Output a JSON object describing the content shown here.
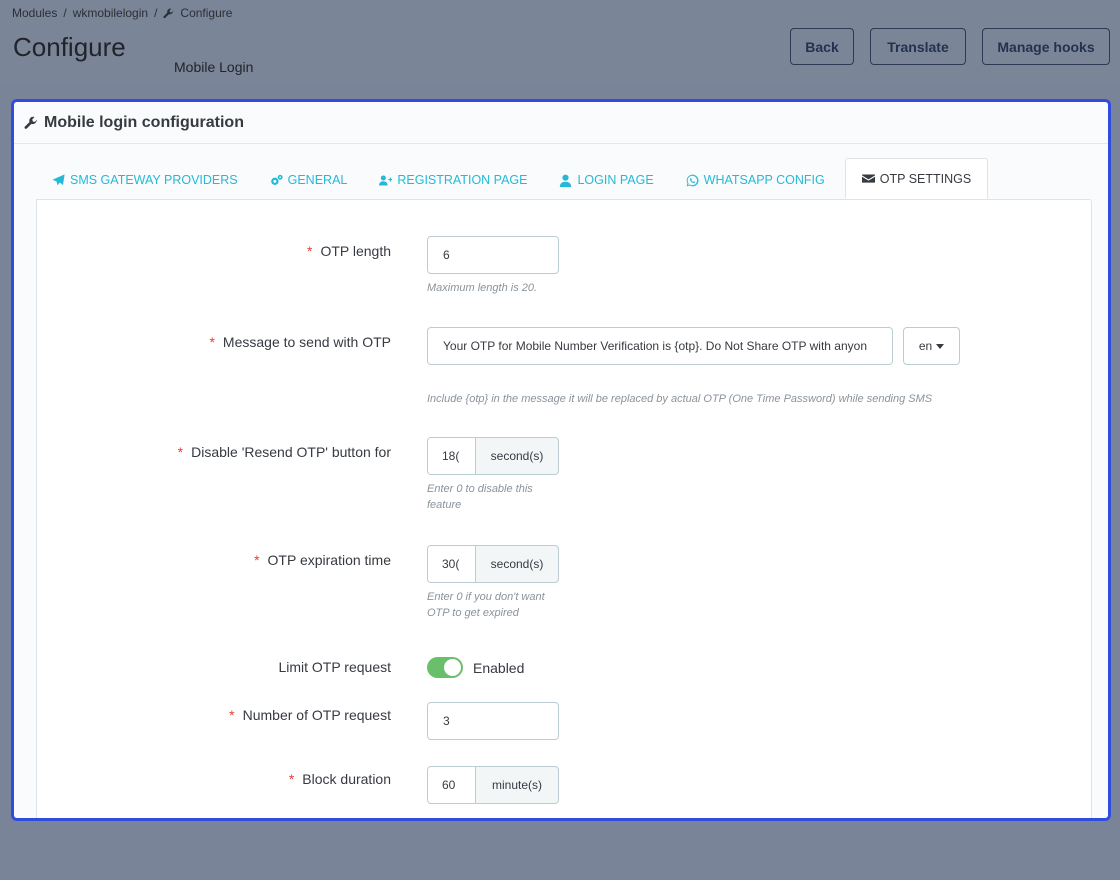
{
  "breadcrumb": {
    "items": [
      "Modules",
      "wkmobilelogin",
      "Configure"
    ]
  },
  "header": {
    "title": "Configure",
    "subtitle": "Mobile Login",
    "buttons": {
      "back": "Back",
      "translate": "Translate",
      "manage_hooks": "Manage hooks"
    }
  },
  "panel": {
    "title": "Mobile login configuration"
  },
  "tabs": [
    {
      "label": "SMS GATEWAY PROVIDERS",
      "icon": "paper-plane-icon"
    },
    {
      "label": "GENERAL",
      "icon": "cogs-icon"
    },
    {
      "label": "REGISTRATION PAGE",
      "icon": "user-plus-icon"
    },
    {
      "label": "LOGIN PAGE",
      "icon": "user-icon"
    },
    {
      "label": "WHATSAPP CONFIG",
      "icon": "whatsapp-icon"
    },
    {
      "label": "OTP SETTINGS",
      "icon": "envelope-icon",
      "active": true
    }
  ],
  "form": {
    "otp_length": {
      "label": "OTP length",
      "value": "6",
      "help": "Maximum length is 20."
    },
    "message": {
      "label": "Message to send with OTP",
      "value": "Your OTP for Mobile Number Verification is {otp}. Do Not Share OTP with anyon",
      "lang": "en",
      "help": "Include {otp} in the message it will be replaced by actual OTP (One Time Password) while sending SMS"
    },
    "resend": {
      "label": "Disable 'Resend OTP' button for",
      "value": "18(",
      "addon": "second(s)",
      "help1": "Enter 0 to disable this",
      "help2": "feature"
    },
    "expiration": {
      "label": "OTP expiration time",
      "value": "30(",
      "addon": "second(s)",
      "help1": "Enter 0 if you don't want",
      "help2": "OTP to get expired"
    },
    "limit": {
      "label": "Limit OTP request",
      "status": "Enabled"
    },
    "num_requests": {
      "label": "Number of OTP request",
      "value": "3"
    },
    "block": {
      "label": "Block duration",
      "value": "60",
      "addon": "minute(s)"
    }
  },
  "colors": {
    "accent": "#25b9d7",
    "panel_border": "#2f4be0",
    "toggle_on": "#6abf6a",
    "required": "#e3403b"
  }
}
